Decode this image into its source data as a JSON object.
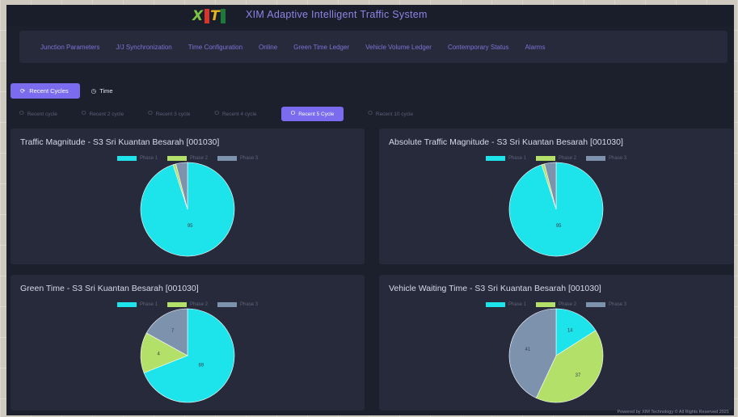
{
  "app": {
    "logo_x": "X",
    "logo_t": "T",
    "title": "XIM Adaptive Intelligent Traffic System"
  },
  "nav": {
    "items": [
      "Junction Parameters",
      "J/J Synchronization",
      "Time Configuration",
      "Online",
      "Green Time Ledger",
      "Vehicle Volume Ledger",
      "Contemporary Status",
      "Alarms"
    ]
  },
  "mode": {
    "recent_cycles_label": "Recent Cycles",
    "time_label": "Time"
  },
  "cycles": {
    "tabs": [
      {
        "label": "Recent cycle",
        "active": false
      },
      {
        "label": "Recent 2 cycle",
        "active": false
      },
      {
        "label": "Recent 3 cycle",
        "active": false
      },
      {
        "label": "Recent 4 cycle",
        "active": false
      },
      {
        "label": "Recent 5 Cycle",
        "active": true
      },
      {
        "label": "Recent 10 cycle",
        "active": false
      }
    ]
  },
  "colors": {
    "phase1": "#1de3ea",
    "phase2": "#b3e068",
    "phase3": "#7d93ad",
    "accent": "#7a6bef"
  },
  "panels": [
    {
      "title": "Traffic Magnitude - S3 Sri Kuantan Besarah [001030]",
      "chart_data": {
        "type": "pie",
        "title": "Traffic Magnitude - S3 Sri Kuantan Besarah [001030]",
        "legend": [
          "Phase 1",
          "Phase 2",
          "Phase 3"
        ],
        "legend_position": "top",
        "values": [
          95,
          1,
          4
        ],
        "labels": [
          "95",
          "",
          ""
        ]
      }
    },
    {
      "title": "Absolute Traffic Magnitude - S3 Sri Kuantan Besarah [001030]",
      "chart_data": {
        "type": "pie",
        "title": "Absolute Traffic Magnitude - S3 Sri Kuantan Besarah [001030]",
        "legend": [
          "Phase 1",
          "Phase 2",
          "Phase 3"
        ],
        "legend_position": "top",
        "values": [
          95,
          1,
          4
        ],
        "labels": [
          "95",
          "",
          ""
        ]
      }
    },
    {
      "title": "Green Time - S3 Sri Kuantan Besarah [001030]",
      "chart_data": {
        "type": "pie",
        "title": "Green Time - S3 Sri Kuantan Besarah [001030]",
        "legend": [
          "Phase 1",
          "Phase 2",
          "Phase 3"
        ],
        "legend_position": "top",
        "values": [
          69,
          14,
          17
        ],
        "labels": [
          "69",
          "4",
          "7"
        ]
      }
    },
    {
      "title": "Vehicle Waiting Time - S3 Sri Kuantan Besarah [001030]",
      "chart_data": {
        "type": "pie",
        "title": "Vehicle Waiting Time - S3 Sri Kuantan Besarah [001030]",
        "legend": [
          "Phase 1",
          "Phase 2",
          "Phase 3"
        ],
        "legend_position": "top",
        "values": [
          16,
          41,
          43
        ],
        "labels": [
          "14",
          "37",
          "41"
        ]
      }
    }
  ],
  "footer": {
    "text": "Powered by XIM Technology © All Rights Reserved 2021"
  }
}
